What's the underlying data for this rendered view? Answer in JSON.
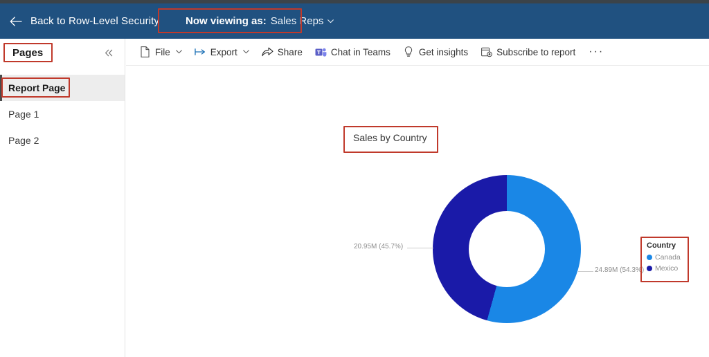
{
  "appbar": {
    "back_icon": "arrow-left-icon",
    "back_label": "Back to Row-Level Security",
    "viewing_as_label": "Now viewing as:",
    "viewing_as_value": "Sales Reps",
    "chevron": "⌄",
    "bg_color": "#205180"
  },
  "sidebar": {
    "title": "Pages",
    "collapse_icon": "«",
    "items": [
      {
        "label": "Report Page",
        "selected": true
      },
      {
        "label": "Page 1",
        "selected": false
      },
      {
        "label": "Page 2",
        "selected": false
      }
    ]
  },
  "toolbar": {
    "items": [
      {
        "label": "File",
        "icon": "file-icon",
        "chevron": "⌄"
      },
      {
        "label": "Export",
        "icon": "export-icon",
        "chevron": "⌄"
      },
      {
        "label": "Share",
        "icon": "share-icon",
        "chevron": ""
      },
      {
        "label": "Chat in Teams",
        "icon": "teams-icon",
        "chevron": ""
      },
      {
        "label": "Get insights",
        "icon": "lightbulb-icon",
        "chevron": ""
      },
      {
        "label": "Subscribe to report",
        "icon": "subscribe-icon",
        "chevron": ""
      }
    ],
    "more_label": "···"
  },
  "chart_data": {
    "type": "pie",
    "title": "Sales by Country",
    "legend_title": "Country",
    "legend_position": "right",
    "labels": [
      "Canada",
      "Mexico"
    ],
    "values": [
      24.89,
      20.95
    ],
    "value_unit": "M",
    "percentages": [
      54.3,
      45.7
    ],
    "data_labels": [
      "24.89M (54.3%)",
      "20.95M (45.7%)"
    ],
    "colors": [
      "#1a87e6",
      "#1a1aa8"
    ],
    "hole_ratio": 0.51,
    "start_angle_deg": 0
  },
  "annotations": {
    "color": "#c0392b",
    "boxes": [
      "viewing-as-annotation",
      "pages-title-annotation",
      "report-page-annotation",
      "chart-title-annotation",
      "legend-annotation"
    ]
  }
}
